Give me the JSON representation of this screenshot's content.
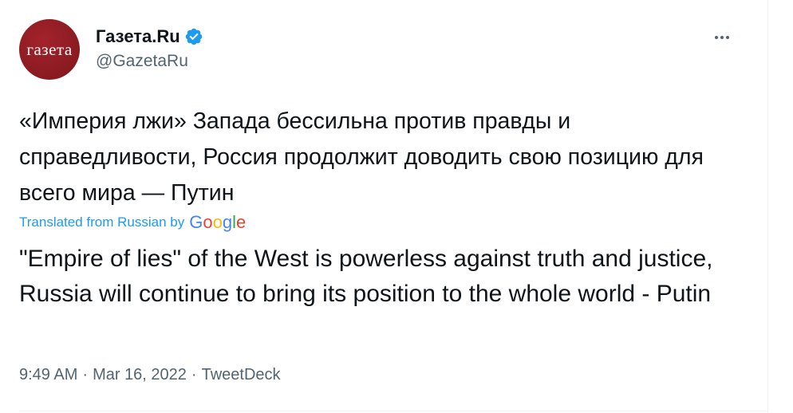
{
  "author": {
    "avatar_text": "газета",
    "display_name": "Газета.Ru",
    "handle": "@GazetaRu",
    "verified": true
  },
  "tweet": {
    "original_text": "«Империя лжи» Запада бессильна против правды и справедливости, Россия продолжит доводить свою позицию для всего мира — Путин",
    "translated_from_label": "Translated from Russian by",
    "translation_provider": "Google",
    "translation_text": "\"Empire of lies\" of the West is powerless against truth and justice, Russia will continue to bring its position to the whole world - Putin",
    "time": "9:49 AM",
    "separator": "·",
    "date": "Mar 16, 2022",
    "source": "TweetDeck"
  },
  "colors": {
    "brand_blue": "#1d9bf0",
    "avatar_red": "#8a1a21",
    "secondary_text": "#536471"
  },
  "icons": {
    "verified": "verified-badge-icon",
    "more": "more-options-icon"
  }
}
